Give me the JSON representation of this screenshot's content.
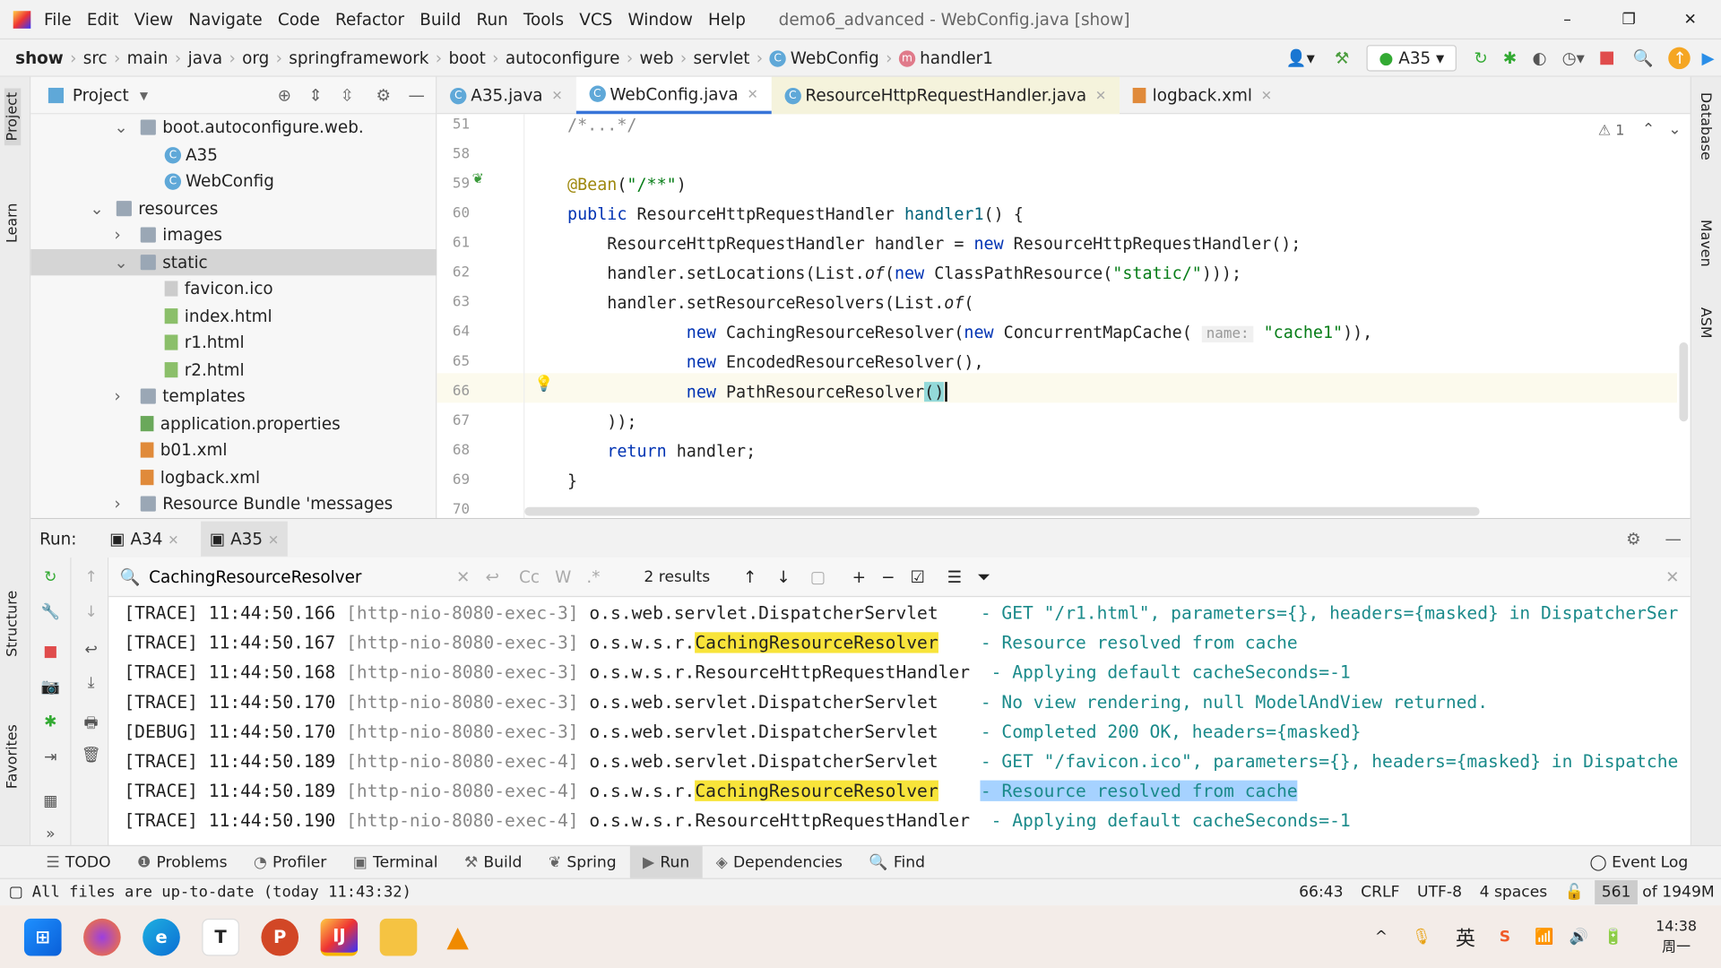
{
  "window": {
    "title": "demo6_advanced - WebConfig.java [show]",
    "menu": [
      "File",
      "Edit",
      "View",
      "Navigate",
      "Code",
      "Refactor",
      "Build",
      "Run",
      "Tools",
      "VCS",
      "Window",
      "Help"
    ],
    "controls": [
      "–",
      "❐",
      "✕"
    ]
  },
  "breadcrumb": [
    "show",
    "src",
    "main",
    "java",
    "org",
    "springframework",
    "boot",
    "autoconfigure",
    "web",
    "servlet",
    "WebConfig",
    "handler1"
  ],
  "run_config": "A35",
  "project": {
    "title": "Project",
    "tree": [
      {
        "label": "boot.autoconfigure.web.",
        "indent": 1,
        "type": "pkg",
        "arrow": "v"
      },
      {
        "label": "A35",
        "indent": 2,
        "type": "class"
      },
      {
        "label": "WebConfig",
        "indent": 2,
        "type": "class"
      },
      {
        "label": "resources",
        "indent": 0,
        "type": "folder",
        "arrow": "v"
      },
      {
        "label": "images",
        "indent": 1,
        "type": "folder",
        "arrow": ">"
      },
      {
        "label": "static",
        "indent": 1,
        "type": "folder",
        "arrow": "v",
        "selected": true
      },
      {
        "label": "favicon.ico",
        "indent": 2,
        "type": "file"
      },
      {
        "label": "index.html",
        "indent": 2,
        "type": "html"
      },
      {
        "label": "r1.html",
        "indent": 2,
        "type": "html"
      },
      {
        "label": "r2.html",
        "indent": 2,
        "type": "html"
      },
      {
        "label": "templates",
        "indent": 1,
        "type": "folder",
        "arrow": ">"
      },
      {
        "label": "application.properties",
        "indent": 1,
        "type": "props"
      },
      {
        "label": "b01.xml",
        "indent": 1,
        "type": "xml"
      },
      {
        "label": "logback.xml",
        "indent": 1,
        "type": "xml"
      },
      {
        "label": "Resource Bundle 'messages",
        "indent": 1,
        "type": "folder",
        "arrow": ">"
      }
    ]
  },
  "editor_tabs": [
    {
      "label": "A35.java"
    },
    {
      "label": "WebConfig.java",
      "active": true
    },
    {
      "label": "ResourceHttpRequestHandler.java"
    },
    {
      "label": "logback.xml"
    }
  ],
  "warnings": "⚠ 1",
  "code": [
    {
      "n": "51",
      "tokens": [
        {
          "t": "/*...*/",
          "c": "cm"
        }
      ]
    },
    {
      "n": "58",
      "tokens": []
    },
    {
      "n": "59",
      "tokens": [
        {
          "t": "@Bean",
          "c": "ann"
        },
        {
          "t": "(",
          "c": ""
        },
        {
          "t": "\"/**\"",
          "c": "str"
        },
        {
          "t": ")",
          "c": ""
        }
      ]
    },
    {
      "n": "60",
      "tokens": [
        {
          "t": "public ",
          "c": "kw"
        },
        {
          "t": "ResourceHttpRequestHandler ",
          "c": ""
        },
        {
          "t": "handler1",
          "c": "fn"
        },
        {
          "t": "() {",
          "c": ""
        }
      ]
    },
    {
      "n": "61",
      "tokens": [
        {
          "t": "    ResourceHttpRequestHandler handler = ",
          "c": ""
        },
        {
          "t": "new ",
          "c": "kw"
        },
        {
          "t": "ResourceHttpRequestHandler();",
          "c": ""
        }
      ]
    },
    {
      "n": "62",
      "tokens": [
        {
          "t": "    handler.setLocations(List.",
          "c": ""
        },
        {
          "t": "of",
          "c": "it"
        },
        {
          "t": "(",
          "c": ""
        },
        {
          "t": "new ",
          "c": "kw"
        },
        {
          "t": "ClassPathResource(",
          "c": ""
        },
        {
          "t": "\"static/\"",
          "c": "str"
        },
        {
          "t": ")));",
          "c": ""
        }
      ]
    },
    {
      "n": "63",
      "tokens": [
        {
          "t": "    handler.setResourceResolvers(List.",
          "c": ""
        },
        {
          "t": "of",
          "c": "it"
        },
        {
          "t": "(",
          "c": ""
        }
      ]
    },
    {
      "n": "64",
      "tokens": [
        {
          "t": "            ",
          "c": ""
        },
        {
          "t": "new ",
          "c": "kw"
        },
        {
          "t": "CachingResourceResolver(",
          "c": ""
        },
        {
          "t": "new ",
          "c": "kw"
        },
        {
          "t": "ConcurrentMapCache( ",
          "c": ""
        },
        {
          "t": "name:",
          "c": "hint"
        },
        {
          "t": " ",
          "c": ""
        },
        {
          "t": "\"cache1\"",
          "c": "str"
        },
        {
          "t": ")),",
          "c": ""
        }
      ]
    },
    {
      "n": "65",
      "tokens": [
        {
          "t": "            ",
          "c": ""
        },
        {
          "t": "new ",
          "c": "kw"
        },
        {
          "t": "EncodedResourceResolver(),",
          "c": ""
        }
      ]
    },
    {
      "n": "66",
      "tokens": [
        {
          "t": "            ",
          "c": ""
        },
        {
          "t": "new ",
          "c": "kw"
        },
        {
          "t": "PathResourceResolver",
          "c": ""
        },
        {
          "t": "()",
          "c": "paren"
        }
      ]
    },
    {
      "n": "67",
      "tokens": [
        {
          "t": "    ));",
          "c": ""
        }
      ]
    },
    {
      "n": "68",
      "tokens": [
        {
          "t": "    ",
          "c": ""
        },
        {
          "t": "return ",
          "c": "kw"
        },
        {
          "t": "handler;",
          "c": ""
        }
      ]
    },
    {
      "n": "69",
      "tokens": [
        {
          "t": "}",
          "c": ""
        }
      ]
    },
    {
      "n": "70",
      "tokens": []
    }
  ],
  "right_tools": [
    "Database",
    "Maven",
    "ASM"
  ],
  "left_tools": [
    "Project",
    "Learn",
    "Structure",
    "Favorites"
  ],
  "run": {
    "label": "Run:",
    "tabs": [
      "A34",
      "A35"
    ],
    "search": "CachingResourceResolver",
    "results": "2 results",
    "search_opts": [
      "Cc",
      "W",
      ".*"
    ]
  },
  "log": [
    {
      "lvl": "[TRACE]",
      "time": "11:44:50.166",
      "thr": "[http-nio-8080-exec-3]",
      "pre": "o.s.web.servlet.DispatcherServlet   ",
      "hit": "",
      "post": "",
      "msg": "- GET \"/r1.html\", parameters={}, headers={masked} in DispatcherSer"
    },
    {
      "lvl": "[TRACE]",
      "time": "11:44:50.167",
      "thr": "[http-nio-8080-exec-3]",
      "pre": "o.s.w.s.r.",
      "hit": "CachingResourceResolver",
      "post": "   ",
      "msg": "- Resource resolved from cache"
    },
    {
      "lvl": "[TRACE]",
      "time": "11:44:50.168",
      "thr": "[http-nio-8080-exec-3]",
      "pre": "o.s.w.s.r.ResourceHttpRequestHandler ",
      "hit": "",
      "post": "",
      "msg": "- Applying default cacheSeconds=-1"
    },
    {
      "lvl": "[TRACE]",
      "time": "11:44:50.170",
      "thr": "[http-nio-8080-exec-3]",
      "pre": "o.s.web.servlet.DispatcherServlet   ",
      "hit": "",
      "post": "",
      "msg": "- No view rendering, null ModelAndView returned."
    },
    {
      "lvl": "[DEBUG]",
      "time": "11:44:50.170",
      "thr": "[http-nio-8080-exec-3]",
      "pre": "o.s.web.servlet.DispatcherServlet   ",
      "hit": "",
      "post": "",
      "msg": "- Completed 200 OK, headers={masked}"
    },
    {
      "lvl": "[TRACE]",
      "time": "11:44:50.189",
      "thr": "[http-nio-8080-exec-4]",
      "pre": "o.s.web.servlet.DispatcherServlet   ",
      "hit": "",
      "post": "",
      "msg": "- GET \"/favicon.ico\", parameters={}, headers={masked} in Dispatche"
    },
    {
      "lvl": "[TRACE]",
      "time": "11:44:50.189",
      "thr": "[http-nio-8080-exec-4]",
      "pre": "o.s.w.s.r.",
      "hit": "CachingResourceResolver",
      "post": "   ",
      "msg": "- Resource resolved from cache",
      "sel": true
    },
    {
      "lvl": "[TRACE]",
      "time": "11:44:50.190",
      "thr": "[http-nio-8080-exec-4]",
      "pre": "o.s.w.s.r.ResourceHttpRequestHandler ",
      "hit": "",
      "post": "",
      "msg": "- Applying default cacheSeconds=-1"
    }
  ],
  "tool_tabs": [
    "TODO",
    "Problems",
    "Profiler",
    "Terminal",
    "Build",
    "Spring",
    "Run",
    "Dependencies",
    "Find"
  ],
  "event_log": "Event Log",
  "status": {
    "message": "All files are up-to-date (today 11:43:32)",
    "position": "66:43",
    "line_sep": "CRLF",
    "encoding": "UTF-8",
    "indent": "4 spaces",
    "memory_used": "561",
    "memory_total": "of 1949M"
  },
  "taskbar": {
    "time": "14:38",
    "day": "周一",
    "ime": "英"
  }
}
